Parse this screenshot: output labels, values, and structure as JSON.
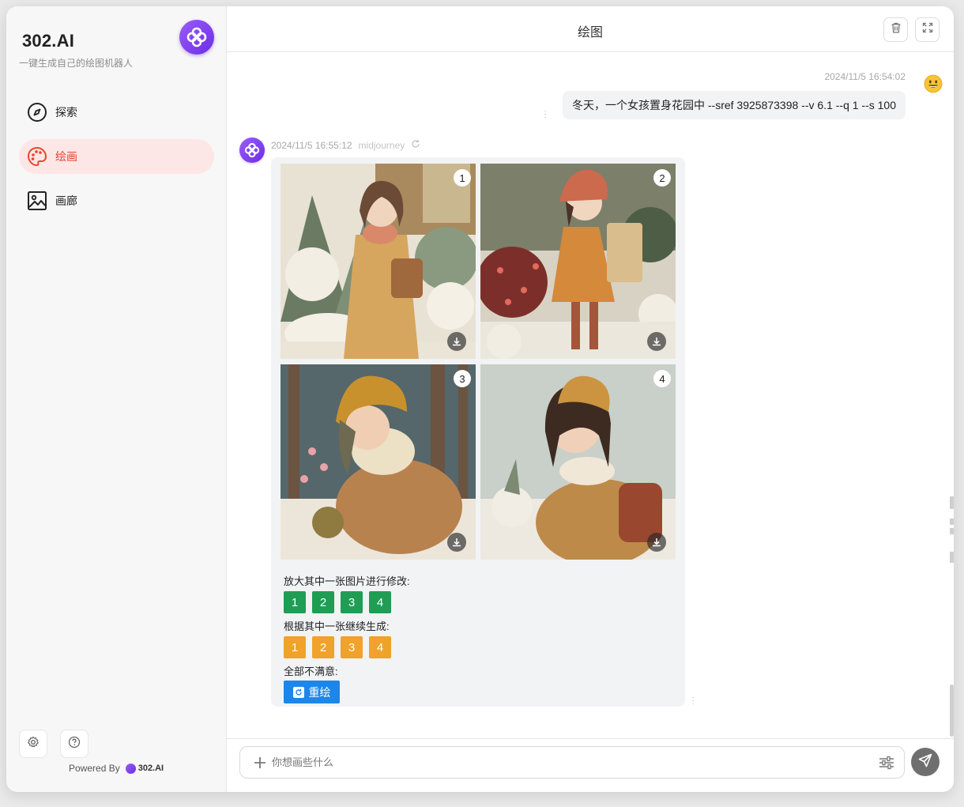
{
  "sidebar": {
    "brand": "302.AI",
    "subtitle": "一键生成自己的绘图机器人",
    "logo_icon": "flower-logo-icon",
    "items": [
      {
        "label": "探索",
        "icon": "compass-icon",
        "active": false
      },
      {
        "label": "绘画",
        "icon": "palette-icon",
        "active": true
      },
      {
        "label": "画廊",
        "icon": "image-icon",
        "active": false
      }
    ],
    "powered_by": "Powered By",
    "powered_brand": "302.AI"
  },
  "header": {
    "title": "绘图"
  },
  "user_message": {
    "time": "2024/11/5 16:54:02",
    "text": "冬天，一个女孩置身花园中 --sref 3925873398 --v 6.1  --q 1  --s 100",
    "avatar": "smiley-face-icon"
  },
  "bot_message": {
    "time": "2024/11/5 16:55:12",
    "model": "midjourney",
    "images": [
      {
        "number": "1"
      },
      {
        "number": "2"
      },
      {
        "number": "3"
      },
      {
        "number": "4"
      }
    ],
    "upscale_label": "放大其中一张图片进行修改:",
    "upscale_buttons": [
      "1",
      "2",
      "3",
      "4"
    ],
    "variation_label": "根据其中一张继续生成:",
    "variation_buttons": [
      "1",
      "2",
      "3",
      "4"
    ],
    "reroll_label": "全部不满意:",
    "reroll_button": "重绘"
  },
  "composer": {
    "placeholder": "你想画些什么"
  },
  "colors": {
    "accent_red": "#e8452c",
    "active_bg": "#fde6e6",
    "green": "#1f9d55",
    "orange": "#f0a22a",
    "blue": "#1d86ea",
    "brand_purple": "#7c3aed"
  }
}
